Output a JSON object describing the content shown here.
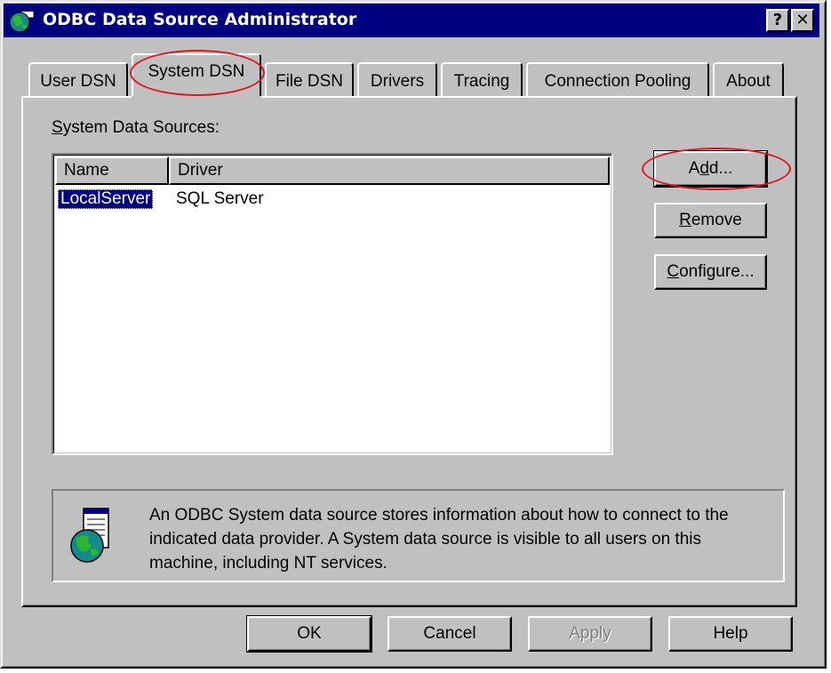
{
  "window": {
    "title": "ODBC Data Source Administrator",
    "help_button": "?",
    "close_button": "✕"
  },
  "tabs": [
    {
      "label": "User DSN",
      "active": false
    },
    {
      "label": "System DSN",
      "active": true
    },
    {
      "label": "File DSN",
      "active": false
    },
    {
      "label": "Drivers",
      "active": false
    },
    {
      "label": "Tracing",
      "active": false
    },
    {
      "label": "Connection Pooling",
      "active": false
    },
    {
      "label": "About",
      "active": false
    }
  ],
  "system_dsn": {
    "section_label_first": "S",
    "section_label_rest": "ystem Data Sources:",
    "columns": [
      "Name",
      "Driver"
    ],
    "rows": [
      {
        "name": "LocalServer",
        "driver": "SQL Server",
        "selected": true
      }
    ],
    "add_button": {
      "pre": "A",
      "key": "d",
      "post": "d..."
    },
    "remove_button": {
      "key": "R",
      "post": "emove"
    },
    "configure_button": {
      "key": "C",
      "post": "onfigure..."
    },
    "info_text": "An ODBC System data source stores information about how to connect to the indicated data provider.   A System data source is visible to all users on this machine, including NT services."
  },
  "footer": {
    "ok": "OK",
    "cancel": "Cancel",
    "apply": "Apply",
    "help": "Help"
  },
  "colors": {
    "titlebar": "#000080",
    "face": "#c0c0c0",
    "highlight_circle": "#e0141e",
    "selection": "#000080"
  },
  "icons": [
    "odbc-globe-icon",
    "odbc-info-globe-icon"
  ]
}
